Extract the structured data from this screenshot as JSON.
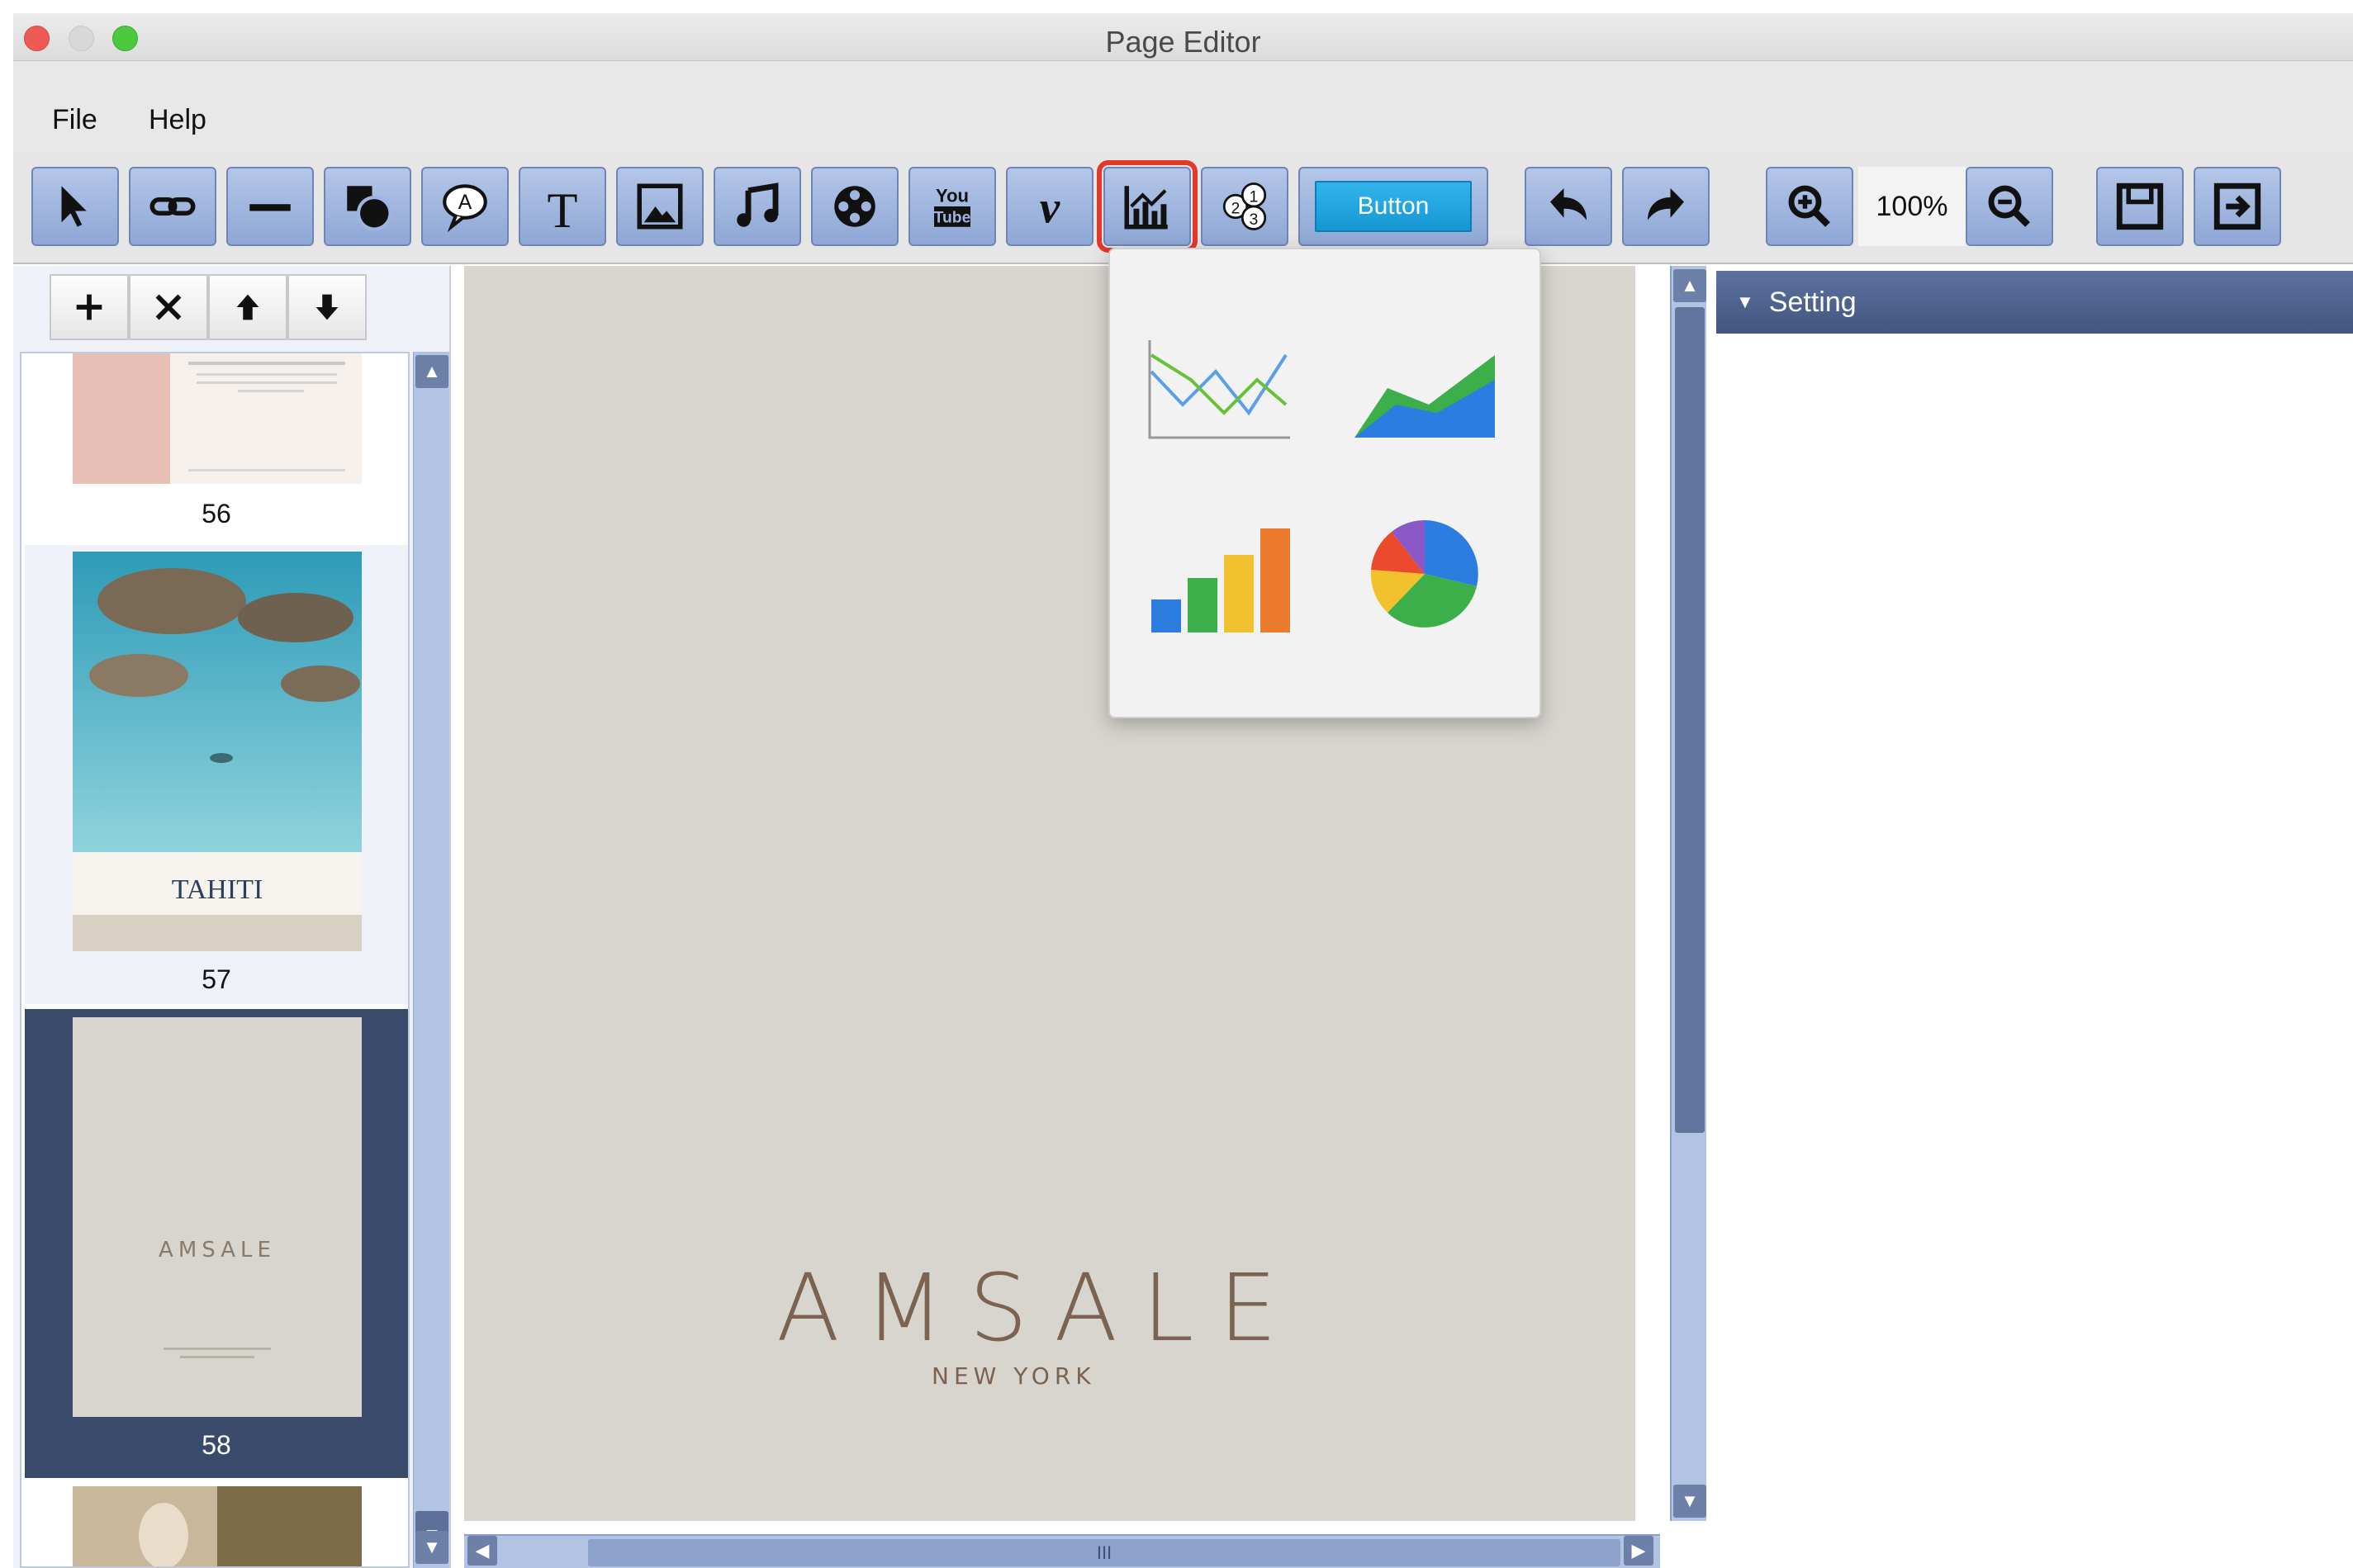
{
  "window": {
    "title": "Page Editor"
  },
  "menu": {
    "file": "File",
    "help": "Help"
  },
  "toolbar": {
    "button_widget_label": "Button",
    "zoom_level": "100%"
  },
  "page_tools": [
    "add",
    "delete",
    "move-up",
    "move-down"
  ],
  "thumbnails": [
    {
      "number": "56",
      "selected": false
    },
    {
      "number": "57",
      "selected": false
    },
    {
      "number": "58",
      "selected": true
    }
  ],
  "canvas": {
    "brand_name": "AMSALE",
    "brand_sub": "NEW YORK"
  },
  "setting_panel": {
    "title": "Setting"
  },
  "chart_popup": {
    "options": [
      "line-chart",
      "area-chart",
      "bar-chart",
      "pie-chart"
    ]
  },
  "colors": {
    "toolbar_button": "#9fb4de",
    "highlight": "#e23a2a",
    "selected_thumb": "#3a4a6a",
    "panel_header": "#4e6290",
    "canvas_bg": "#d8d5cf"
  }
}
